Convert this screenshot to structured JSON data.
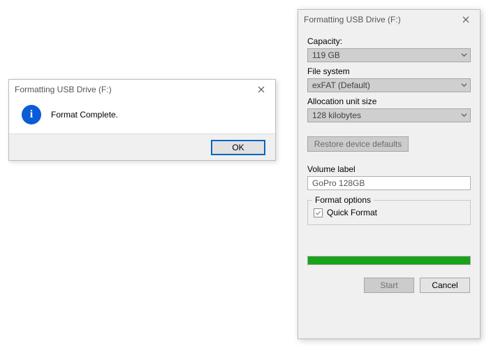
{
  "message_dialog": {
    "title": "Formatting USB Drive (F:)",
    "icon_name": "info-icon",
    "body": "Format Complete.",
    "ok_label": "OK"
  },
  "format_dialog": {
    "title": "Formatting USB Drive (F:)",
    "capacity": {
      "label": "Capacity:",
      "value": "119 GB"
    },
    "file_system": {
      "label": "File system",
      "value": "exFAT (Default)"
    },
    "allocation": {
      "label": "Allocation unit size",
      "value": "128 kilobytes"
    },
    "restore_label": "Restore device defaults",
    "volume": {
      "label": "Volume label",
      "value": "GoPro 128GB"
    },
    "options": {
      "legend": "Format options",
      "quick_format": {
        "label": "Quick Format",
        "checked": true
      }
    },
    "progress_percent": 100,
    "start_label": "Start",
    "cancel_label": "Cancel"
  }
}
